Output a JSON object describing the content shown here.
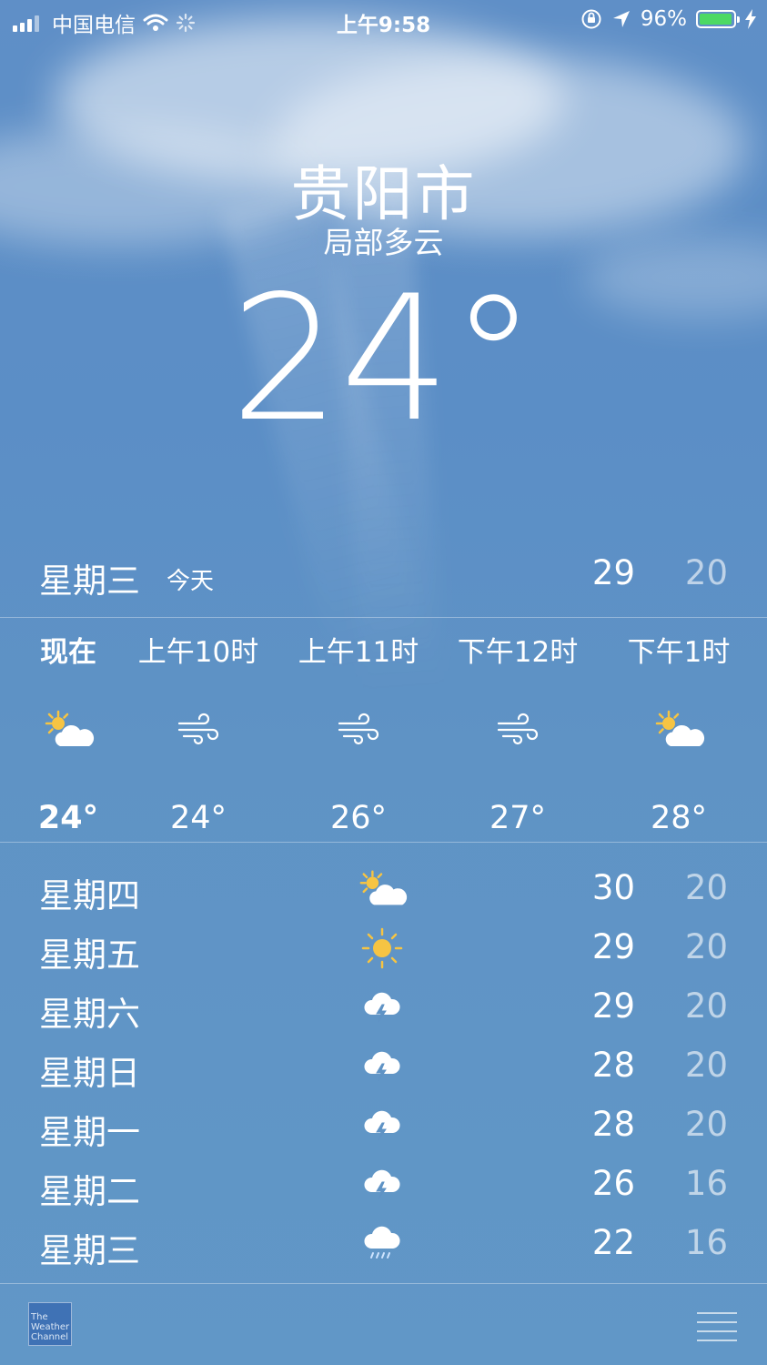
{
  "status_bar": {
    "carrier": "中国电信",
    "time": "上午9:58",
    "battery_percent": "96%",
    "battery_level": 0.96,
    "battery_color": "#4cd964"
  },
  "location": {
    "city": "贵阳市",
    "condition": "局部多云",
    "temperature": "24°"
  },
  "today": {
    "day": "星期三",
    "tag": "今天",
    "high": "29",
    "low": "20"
  },
  "hourly": [
    {
      "label": "现在",
      "icon": "partly-sunny-icon",
      "temp": "24°"
    },
    {
      "label": "上午10时",
      "icon": "wind-icon",
      "temp": "24°"
    },
    {
      "label": "上午11时",
      "icon": "wind-icon",
      "temp": "26°"
    },
    {
      "label": "下午12时",
      "icon": "wind-icon",
      "temp": "27°"
    },
    {
      "label": "下午1时",
      "icon": "partly-sunny-icon",
      "temp": "28°"
    }
  ],
  "daily": [
    {
      "day": "星期四",
      "icon": "partly-sunny-icon",
      "high": "30",
      "low": "20"
    },
    {
      "day": "星期五",
      "icon": "sun-icon",
      "high": "29",
      "low": "20"
    },
    {
      "day": "星期六",
      "icon": "thunderstorm-icon",
      "high": "29",
      "low": "20"
    },
    {
      "day": "星期日",
      "icon": "thunderstorm-icon",
      "high": "28",
      "low": "20"
    },
    {
      "day": "星期一",
      "icon": "thunderstorm-icon",
      "high": "28",
      "low": "20"
    },
    {
      "day": "星期二",
      "icon": "thunderstorm-icon",
      "high": "26",
      "low": "16"
    },
    {
      "day": "星期三",
      "icon": "rain-icon",
      "high": "22",
      "low": "16"
    }
  ],
  "footer": {
    "logo_text": [
      "The",
      "Weather",
      "Channel"
    ]
  }
}
